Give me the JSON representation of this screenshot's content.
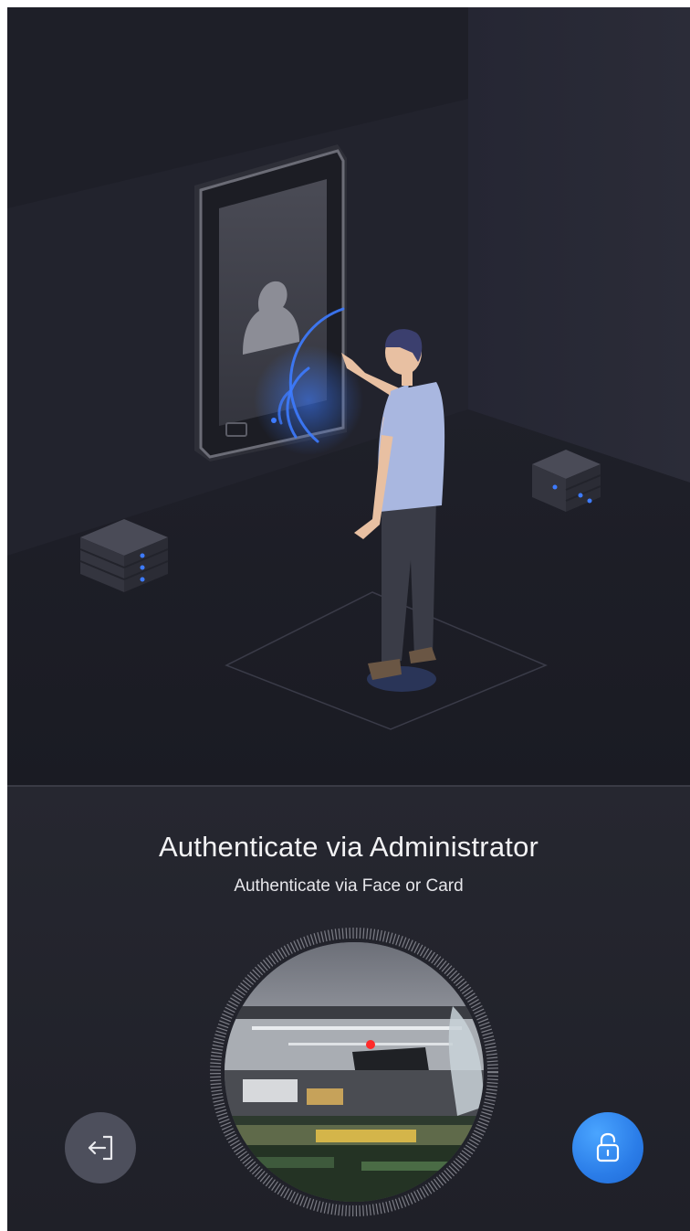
{
  "hero": {
    "illustration": "person-authenticating-at-face-terminal",
    "colors": {
      "background": "#20212a",
      "accent": "#3d7bff",
      "shirt": "#a9b7e0"
    }
  },
  "auth": {
    "title": "Authenticate via Administrator",
    "subtitle": "Authenticate via Face or Card"
  },
  "camera": {
    "feed": "live-camera-preview"
  },
  "buttons": {
    "exit": {
      "icon": "exit-icon",
      "color": "#4d4f5c"
    },
    "unlock": {
      "icon": "unlock-icon",
      "color": "#2b7de8"
    }
  }
}
